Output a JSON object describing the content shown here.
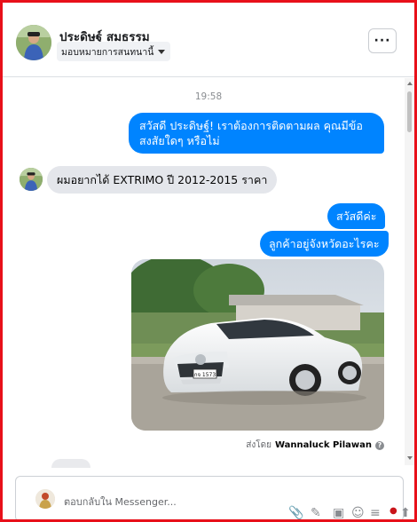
{
  "header": {
    "contact_name": "ประดิษฐ์ สมธรรม",
    "assign_label": "มอบหมายการสนทนานี้",
    "more_label": "···"
  },
  "thread": {
    "timestamp": "19:58",
    "messages": [
      {
        "direction": "outgoing",
        "text": "สวัสดี ประดิษฐ์! เราต้องการติดตามผล คุณมีข้อสงสัยใดๆ หรือไม่"
      },
      {
        "direction": "incoming",
        "text": "ผมอยากได้ EXTRIMO ปี 2012-2015 ราคา"
      },
      {
        "direction": "outgoing",
        "text": "สวัสดีค่ะ"
      },
      {
        "direction": "outgoing",
        "text": "ลูกค้าอยู่จังหวัดอะไรคะ"
      }
    ],
    "photo": {
      "plate": "กจ 1573"
    },
    "sent_by_prefix": "ส่งโดย",
    "sent_by_name": "Wannaluck Pilawan",
    "help_icon": "?"
  },
  "composer": {
    "placeholder": "ตอบกลับใน Messenger..."
  },
  "colors": {
    "accent": "#0084ff",
    "incoming_bubble": "#e4e6eb",
    "frame": "#e8101a"
  }
}
